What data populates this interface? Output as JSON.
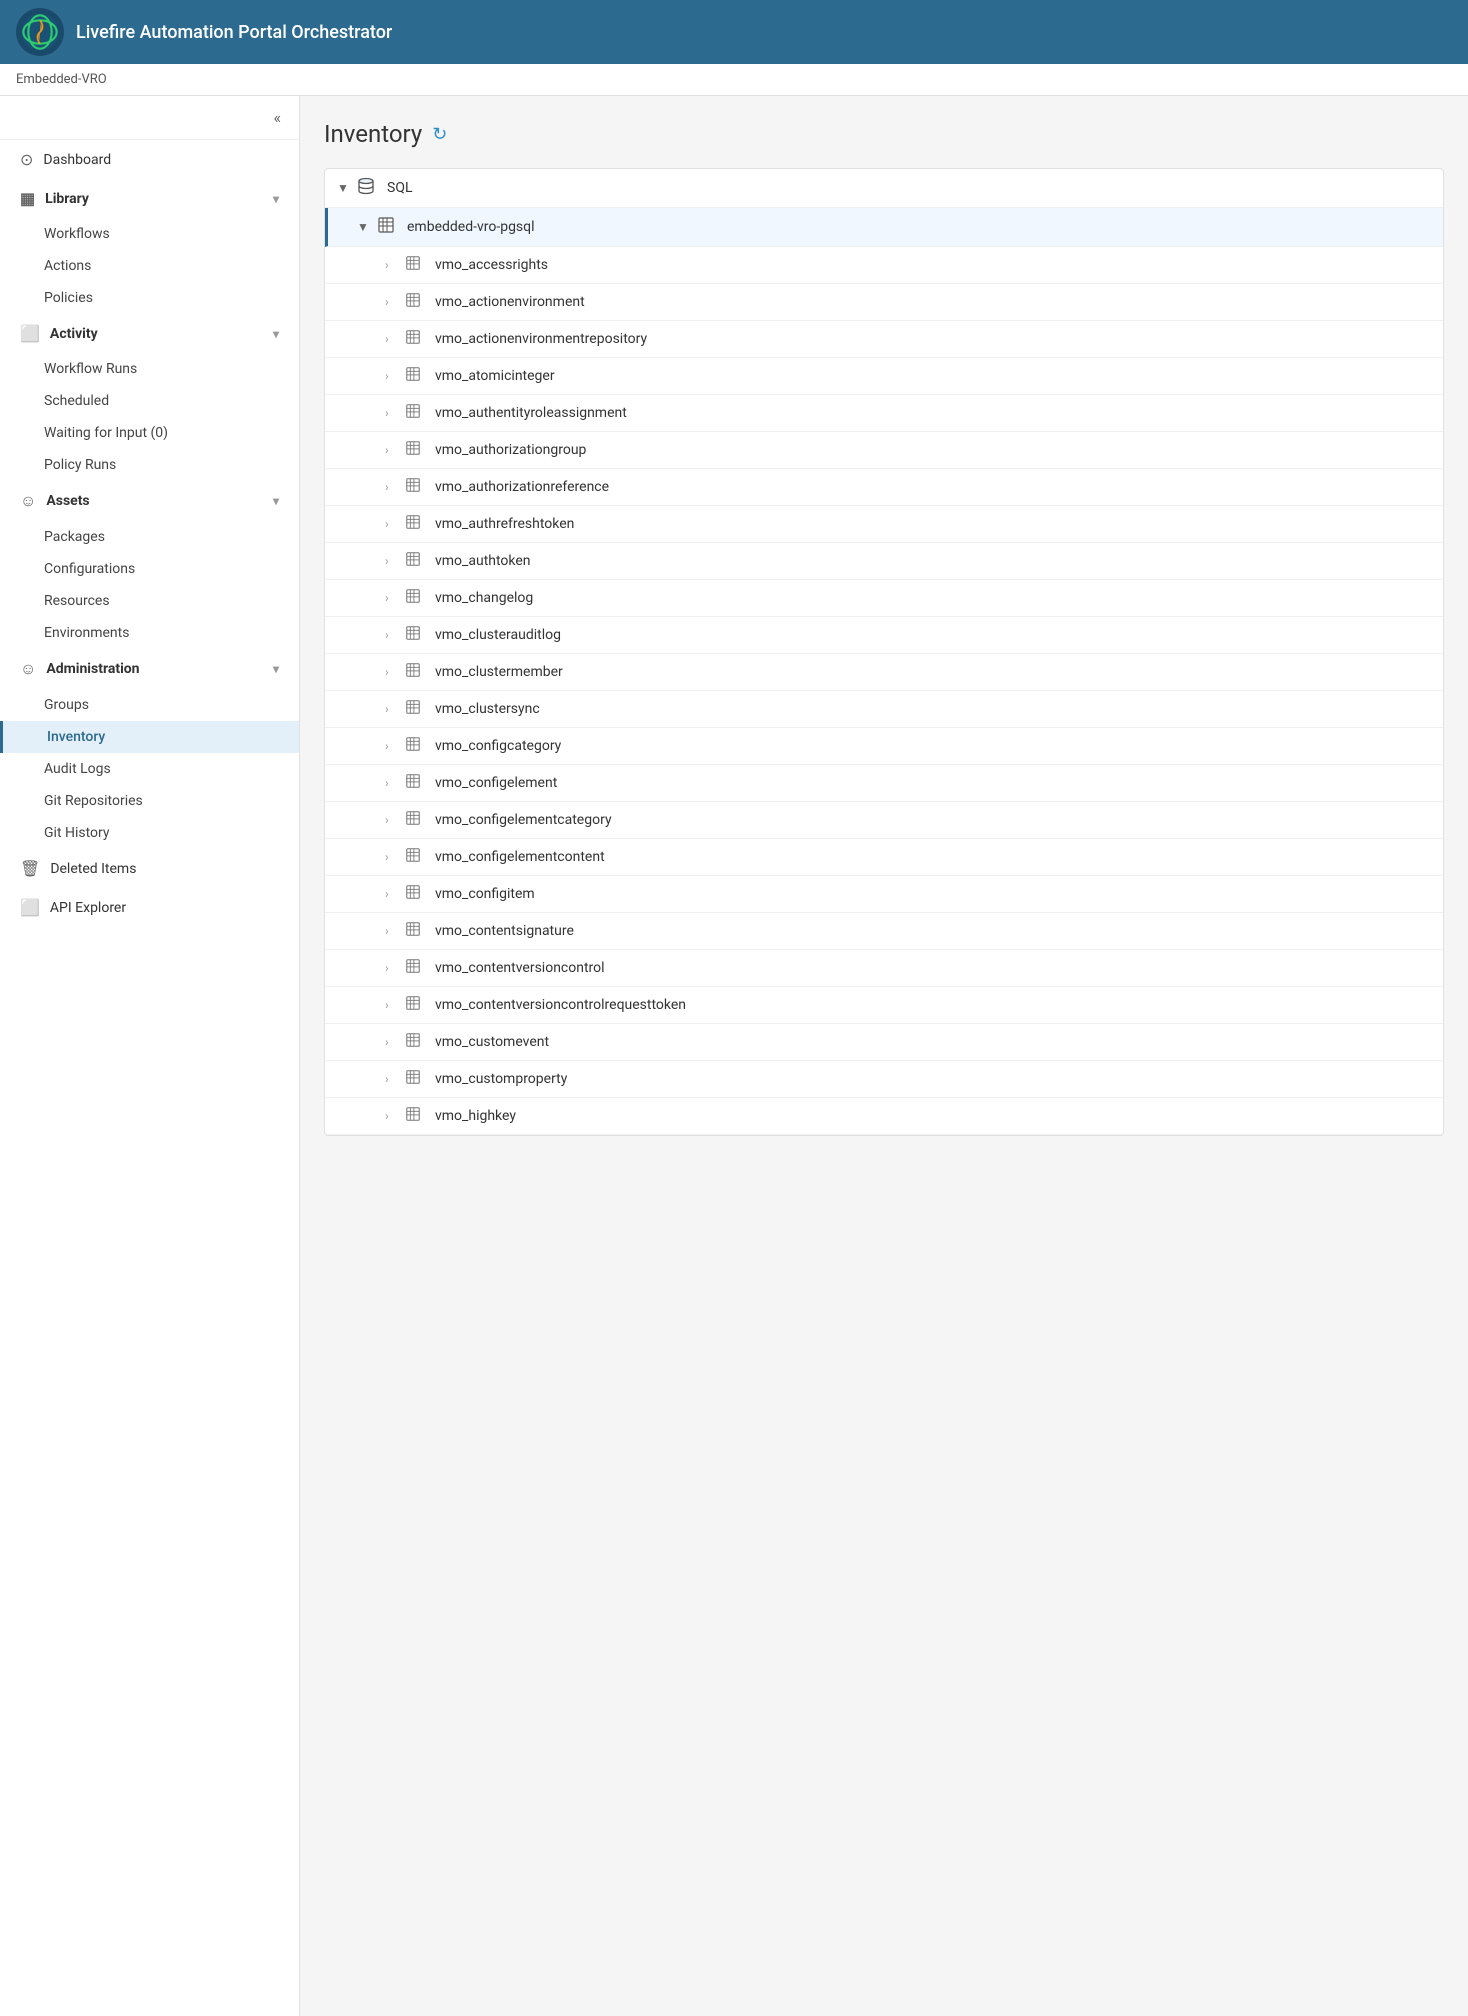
{
  "header": {
    "title": "Livefire Automation Portal Orchestrator",
    "logo_alt": "logo"
  },
  "breadcrumb": "Embedded-VRO",
  "sidebar": {
    "collapse_label": "«",
    "nav_items": [
      {
        "id": "dashboard",
        "label": "Dashboard",
        "icon": "⊙",
        "type": "item",
        "level": 0
      },
      {
        "id": "library",
        "label": "Library",
        "icon": "▦",
        "type": "section",
        "expanded": true,
        "level": 0
      },
      {
        "id": "workflows",
        "label": "Workflows",
        "type": "sub",
        "level": 1
      },
      {
        "id": "actions",
        "label": "Actions",
        "type": "sub",
        "level": 1
      },
      {
        "id": "policies",
        "label": "Policies",
        "type": "sub",
        "level": 1
      },
      {
        "id": "activity",
        "label": "Activity",
        "icon": "⬜",
        "type": "section",
        "expanded": true,
        "level": 0
      },
      {
        "id": "workflow-runs",
        "label": "Workflow Runs",
        "type": "sub",
        "level": 1
      },
      {
        "id": "scheduled",
        "label": "Scheduled",
        "type": "sub",
        "level": 1
      },
      {
        "id": "waiting-for-input",
        "label": "Waiting for Input (0)",
        "type": "sub",
        "level": 1
      },
      {
        "id": "policy-runs",
        "label": "Policy Runs",
        "type": "sub",
        "level": 1
      },
      {
        "id": "assets",
        "label": "Assets",
        "icon": "☺",
        "type": "section",
        "expanded": true,
        "level": 0
      },
      {
        "id": "packages",
        "label": "Packages",
        "type": "sub",
        "level": 1
      },
      {
        "id": "configurations",
        "label": "Configurations",
        "type": "sub",
        "level": 1
      },
      {
        "id": "resources",
        "label": "Resources",
        "type": "sub",
        "level": 1
      },
      {
        "id": "environments",
        "label": "Environments",
        "type": "sub",
        "level": 1
      },
      {
        "id": "administration",
        "label": "Administration",
        "icon": "☺",
        "type": "section",
        "expanded": true,
        "level": 0
      },
      {
        "id": "groups",
        "label": "Groups",
        "type": "sub",
        "level": 1
      },
      {
        "id": "inventory",
        "label": "Inventory",
        "type": "sub",
        "level": 1,
        "active": true
      },
      {
        "id": "audit-logs",
        "label": "Audit Logs",
        "type": "sub",
        "level": 1
      },
      {
        "id": "git-repositories",
        "label": "Git Repositories",
        "type": "sub",
        "level": 1
      },
      {
        "id": "git-history",
        "label": "Git History",
        "type": "sub",
        "level": 1
      },
      {
        "id": "deleted-items",
        "label": "Deleted Items",
        "icon": "🗑",
        "type": "item",
        "level": 0
      },
      {
        "id": "api-explorer",
        "label": "API Explorer",
        "icon": "⬜",
        "type": "item",
        "level": 0
      }
    ]
  },
  "page": {
    "title": "Inventory",
    "refresh_icon": "↻"
  },
  "tree": {
    "items": [
      {
        "id": "sql",
        "label": "SQL",
        "icon": "db",
        "level": 0,
        "arrow": "▼",
        "selected": false
      },
      {
        "id": "embedded-vro-pgsql",
        "label": "embedded-vro-pgsql",
        "icon": "table",
        "level": 1,
        "arrow": "▼",
        "selected": true
      },
      {
        "id": "vmo_accessrights",
        "label": "vmo_accessrights",
        "icon": "table",
        "level": 2,
        "arrow": "›",
        "selected": false
      },
      {
        "id": "vmo_actionenvironment",
        "label": "vmo_actionenvironment",
        "icon": "table",
        "level": 2,
        "arrow": "›",
        "selected": false
      },
      {
        "id": "vmo_actionenvironmentrepository",
        "label": "vmo_actionenvironmentrepository",
        "icon": "table",
        "level": 2,
        "arrow": "›",
        "selected": false
      },
      {
        "id": "vmo_atomicinteger",
        "label": "vmo_atomicinteger",
        "icon": "table",
        "level": 2,
        "arrow": "›",
        "selected": false
      },
      {
        "id": "vmo_authentityroleassignment",
        "label": "vmo_authentityroleassignment",
        "icon": "table",
        "level": 2,
        "arrow": "›",
        "selected": false
      },
      {
        "id": "vmo_authorizationgroup",
        "label": "vmo_authorizationgroup",
        "icon": "table",
        "level": 2,
        "arrow": "›",
        "selected": false
      },
      {
        "id": "vmo_authorizationreference",
        "label": "vmo_authorizationreference",
        "icon": "table",
        "level": 2,
        "arrow": "›",
        "selected": false
      },
      {
        "id": "vmo_authrefreshtoken",
        "label": "vmo_authrefreshtoken",
        "icon": "table",
        "level": 2,
        "arrow": "›",
        "selected": false
      },
      {
        "id": "vmo_authtoken",
        "label": "vmo_authtoken",
        "icon": "table",
        "level": 2,
        "arrow": "›",
        "selected": false
      },
      {
        "id": "vmo_changelog",
        "label": "vmo_changelog",
        "icon": "table",
        "level": 2,
        "arrow": "›",
        "selected": false
      },
      {
        "id": "vmo_clusterauditlog",
        "label": "vmo_clusterauditlog",
        "icon": "table",
        "level": 2,
        "arrow": "›",
        "selected": false
      },
      {
        "id": "vmo_clustermember",
        "label": "vmo_clustermember",
        "icon": "table",
        "level": 2,
        "arrow": "›",
        "selected": false
      },
      {
        "id": "vmo_clustersync",
        "label": "vmo_clustersync",
        "icon": "table",
        "level": 2,
        "arrow": "›",
        "selected": false
      },
      {
        "id": "vmo_configcategory",
        "label": "vmo_configcategory",
        "icon": "table",
        "level": 2,
        "arrow": "›",
        "selected": false
      },
      {
        "id": "vmo_configelement",
        "label": "vmo_configelement",
        "icon": "table",
        "level": 2,
        "arrow": "›",
        "selected": false
      },
      {
        "id": "vmo_configelementcategory",
        "label": "vmo_configelementcategory",
        "icon": "table",
        "level": 2,
        "arrow": "›",
        "selected": false
      },
      {
        "id": "vmo_configelementcontent",
        "label": "vmo_configelementcontent",
        "icon": "table",
        "level": 2,
        "arrow": "›",
        "selected": false
      },
      {
        "id": "vmo_configitem",
        "label": "vmo_configitem",
        "icon": "table",
        "level": 2,
        "arrow": "›",
        "selected": false
      },
      {
        "id": "vmo_contentsignature",
        "label": "vmo_contentsignature",
        "icon": "table",
        "level": 2,
        "arrow": "›",
        "selected": false
      },
      {
        "id": "vmo_contentversioncontrol",
        "label": "vmo_contentversioncontrol",
        "icon": "table",
        "level": 2,
        "arrow": "›",
        "selected": false
      },
      {
        "id": "vmo_contentversioncontrolrequesttoken",
        "label": "vmo_contentversioncontrolrequesttoken",
        "icon": "table",
        "level": 2,
        "arrow": "›",
        "selected": false
      },
      {
        "id": "vmo_customevent",
        "label": "vmo_customevent",
        "icon": "table",
        "level": 2,
        "arrow": "›",
        "selected": false
      },
      {
        "id": "vmo_customproperty",
        "label": "vmo_customproperty",
        "icon": "table",
        "level": 2,
        "arrow": "›",
        "selected": false
      },
      {
        "id": "vmo_highkey",
        "label": "vmo_highkey",
        "icon": "table",
        "level": 2,
        "arrow": "›",
        "selected": false
      }
    ]
  }
}
